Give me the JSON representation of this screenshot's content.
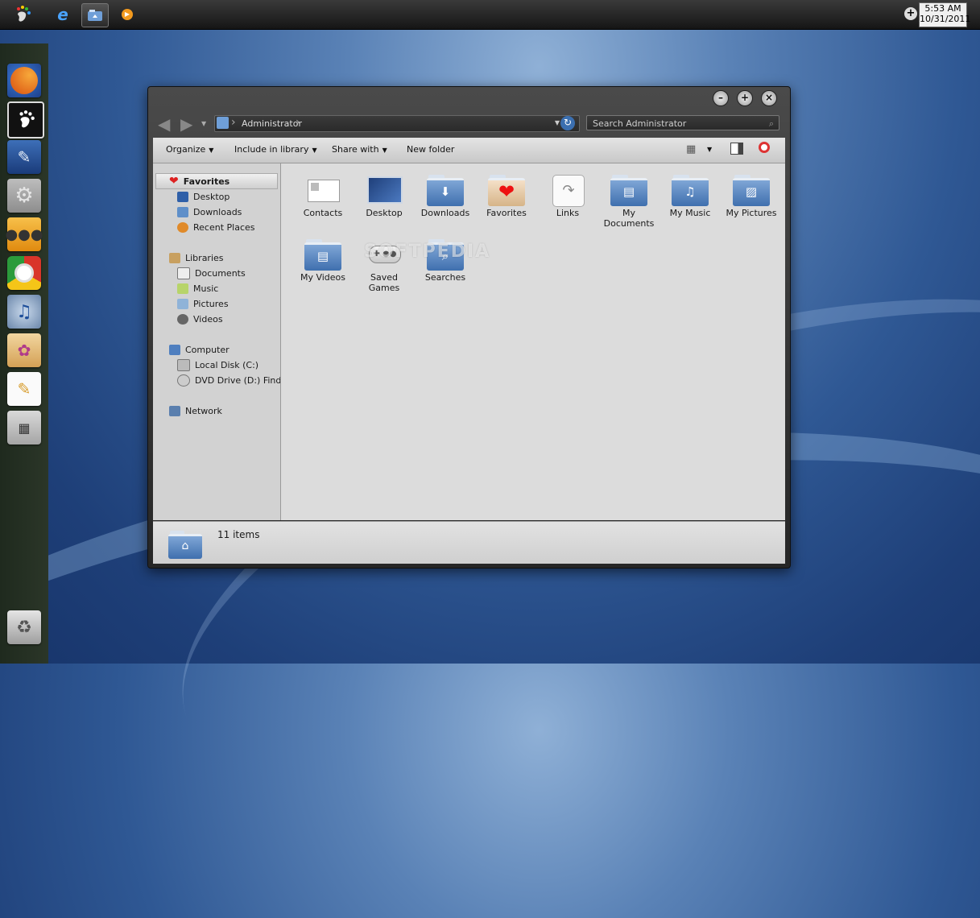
{
  "taskbar": {
    "items": [
      {
        "icon": "gnome-foot-icon"
      },
      {
        "icon": "internet-explorer-icon"
      },
      {
        "icon": "explorer-icon",
        "active": true
      },
      {
        "icon": "media-player-icon"
      }
    ],
    "clock_time": "5:53 AM",
    "clock_date": "10/31/2011"
  },
  "dock": {
    "icons": [
      "firefox-icon",
      "gnome-icon",
      "paint-tablet-icon",
      "gears-icon",
      "users-icon",
      "chrome-icon",
      "itunes-icon",
      "palette-icon",
      "notepad-icon",
      "calculator-icon",
      "recycle-bin-icon"
    ]
  },
  "window": {
    "address": "Administrator",
    "search_placeholder": "Search Administrator",
    "toolbar": {
      "organize": "Organize",
      "include_in_library": "Include in library",
      "share_with": "Share with",
      "new_folder": "New folder"
    },
    "nav": {
      "favorites": "Favorites",
      "desktop": "Desktop",
      "downloads": "Downloads",
      "recent_places": "Recent Places",
      "libraries": "Libraries",
      "documents": "Documents",
      "music": "Music",
      "pictures": "Pictures",
      "videos": "Videos",
      "computer": "Computer",
      "local_disk": "Local Disk (C:)",
      "dvd_drive": "DVD Drive (D:) Finding",
      "network": "Network"
    },
    "items": [
      {
        "label": "Contacts",
        "icon": "contacts-icon"
      },
      {
        "label": "Desktop",
        "icon": "desktop-icon"
      },
      {
        "label": "Downloads",
        "icon": "downloads-folder-icon"
      },
      {
        "label": "Favorites",
        "icon": "favorites-folder-icon"
      },
      {
        "label": "Links",
        "icon": "links-icon"
      },
      {
        "label": "My Documents",
        "icon": "documents-folder-icon"
      },
      {
        "label": "My Music",
        "icon": "music-folder-icon"
      },
      {
        "label": "My Pictures",
        "icon": "pictures-folder-icon"
      },
      {
        "label": "My Videos",
        "icon": "videos-folder-icon"
      },
      {
        "label": "Saved Games",
        "icon": "gamepad-icon"
      },
      {
        "label": "Searches",
        "icon": "searches-folder-icon"
      }
    ],
    "status": "11 items"
  },
  "watermark": "SOFTPEDIA"
}
